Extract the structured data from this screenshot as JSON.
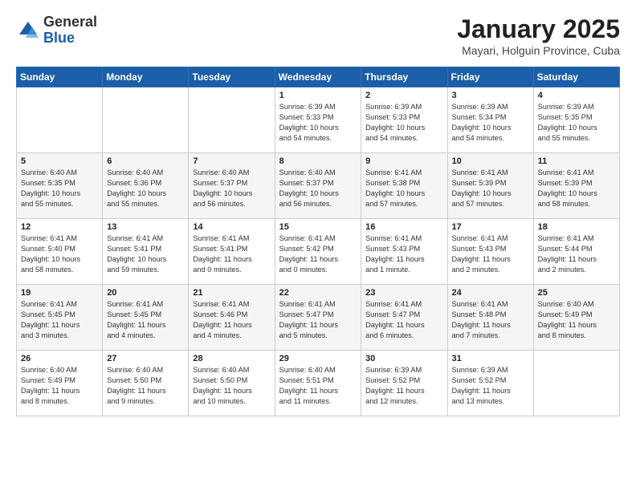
{
  "header": {
    "logo_general": "General",
    "logo_blue": "Blue",
    "month_title": "January 2025",
    "location": "Mayari, Holguin Province, Cuba"
  },
  "weekdays": [
    "Sunday",
    "Monday",
    "Tuesday",
    "Wednesday",
    "Thursday",
    "Friday",
    "Saturday"
  ],
  "weeks": [
    [
      {
        "day": "",
        "info": ""
      },
      {
        "day": "",
        "info": ""
      },
      {
        "day": "",
        "info": ""
      },
      {
        "day": "1",
        "info": "Sunrise: 6:39 AM\nSunset: 5:33 PM\nDaylight: 10 hours\nand 54 minutes."
      },
      {
        "day": "2",
        "info": "Sunrise: 6:39 AM\nSunset: 5:33 PM\nDaylight: 10 hours\nand 54 minutes."
      },
      {
        "day": "3",
        "info": "Sunrise: 6:39 AM\nSunset: 5:34 PM\nDaylight: 10 hours\nand 54 minutes."
      },
      {
        "day": "4",
        "info": "Sunrise: 6:39 AM\nSunset: 5:35 PM\nDaylight: 10 hours\nand 55 minutes."
      }
    ],
    [
      {
        "day": "5",
        "info": "Sunrise: 6:40 AM\nSunset: 5:35 PM\nDaylight: 10 hours\nand 55 minutes."
      },
      {
        "day": "6",
        "info": "Sunrise: 6:40 AM\nSunset: 5:36 PM\nDaylight: 10 hours\nand 55 minutes."
      },
      {
        "day": "7",
        "info": "Sunrise: 6:40 AM\nSunset: 5:37 PM\nDaylight: 10 hours\nand 56 minutes."
      },
      {
        "day": "8",
        "info": "Sunrise: 6:40 AM\nSunset: 5:37 PM\nDaylight: 10 hours\nand 56 minutes."
      },
      {
        "day": "9",
        "info": "Sunrise: 6:41 AM\nSunset: 5:38 PM\nDaylight: 10 hours\nand 57 minutes."
      },
      {
        "day": "10",
        "info": "Sunrise: 6:41 AM\nSunset: 5:39 PM\nDaylight: 10 hours\nand 57 minutes."
      },
      {
        "day": "11",
        "info": "Sunrise: 6:41 AM\nSunset: 5:39 PM\nDaylight: 10 hours\nand 58 minutes."
      }
    ],
    [
      {
        "day": "12",
        "info": "Sunrise: 6:41 AM\nSunset: 5:40 PM\nDaylight: 10 hours\nand 58 minutes."
      },
      {
        "day": "13",
        "info": "Sunrise: 6:41 AM\nSunset: 5:41 PM\nDaylight: 10 hours\nand 59 minutes."
      },
      {
        "day": "14",
        "info": "Sunrise: 6:41 AM\nSunset: 5:41 PM\nDaylight: 11 hours\nand 0 minutes."
      },
      {
        "day": "15",
        "info": "Sunrise: 6:41 AM\nSunset: 5:42 PM\nDaylight: 11 hours\nand 0 minutes."
      },
      {
        "day": "16",
        "info": "Sunrise: 6:41 AM\nSunset: 5:43 PM\nDaylight: 11 hours\nand 1 minute."
      },
      {
        "day": "17",
        "info": "Sunrise: 6:41 AM\nSunset: 5:43 PM\nDaylight: 11 hours\nand 2 minutes."
      },
      {
        "day": "18",
        "info": "Sunrise: 6:41 AM\nSunset: 5:44 PM\nDaylight: 11 hours\nand 2 minutes."
      }
    ],
    [
      {
        "day": "19",
        "info": "Sunrise: 6:41 AM\nSunset: 5:45 PM\nDaylight: 11 hours\nand 3 minutes."
      },
      {
        "day": "20",
        "info": "Sunrise: 6:41 AM\nSunset: 5:45 PM\nDaylight: 11 hours\nand 4 minutes."
      },
      {
        "day": "21",
        "info": "Sunrise: 6:41 AM\nSunset: 5:46 PM\nDaylight: 11 hours\nand 4 minutes."
      },
      {
        "day": "22",
        "info": "Sunrise: 6:41 AM\nSunset: 5:47 PM\nDaylight: 11 hours\nand 5 minutes."
      },
      {
        "day": "23",
        "info": "Sunrise: 6:41 AM\nSunset: 5:47 PM\nDaylight: 11 hours\nand 6 minutes."
      },
      {
        "day": "24",
        "info": "Sunrise: 6:41 AM\nSunset: 5:48 PM\nDaylight: 11 hours\nand 7 minutes."
      },
      {
        "day": "25",
        "info": "Sunrise: 6:40 AM\nSunset: 5:49 PM\nDaylight: 11 hours\nand 8 minutes."
      }
    ],
    [
      {
        "day": "26",
        "info": "Sunrise: 6:40 AM\nSunset: 5:49 PM\nDaylight: 11 hours\nand 8 minutes."
      },
      {
        "day": "27",
        "info": "Sunrise: 6:40 AM\nSunset: 5:50 PM\nDaylight: 11 hours\nand 9 minutes."
      },
      {
        "day": "28",
        "info": "Sunrise: 6:40 AM\nSunset: 5:50 PM\nDaylight: 11 hours\nand 10 minutes."
      },
      {
        "day": "29",
        "info": "Sunrise: 6:40 AM\nSunset: 5:51 PM\nDaylight: 11 hours\nand 11 minutes."
      },
      {
        "day": "30",
        "info": "Sunrise: 6:39 AM\nSunset: 5:52 PM\nDaylight: 11 hours\nand 12 minutes."
      },
      {
        "day": "31",
        "info": "Sunrise: 6:39 AM\nSunset: 5:52 PM\nDaylight: 11 hours\nand 13 minutes."
      },
      {
        "day": "",
        "info": ""
      }
    ]
  ]
}
